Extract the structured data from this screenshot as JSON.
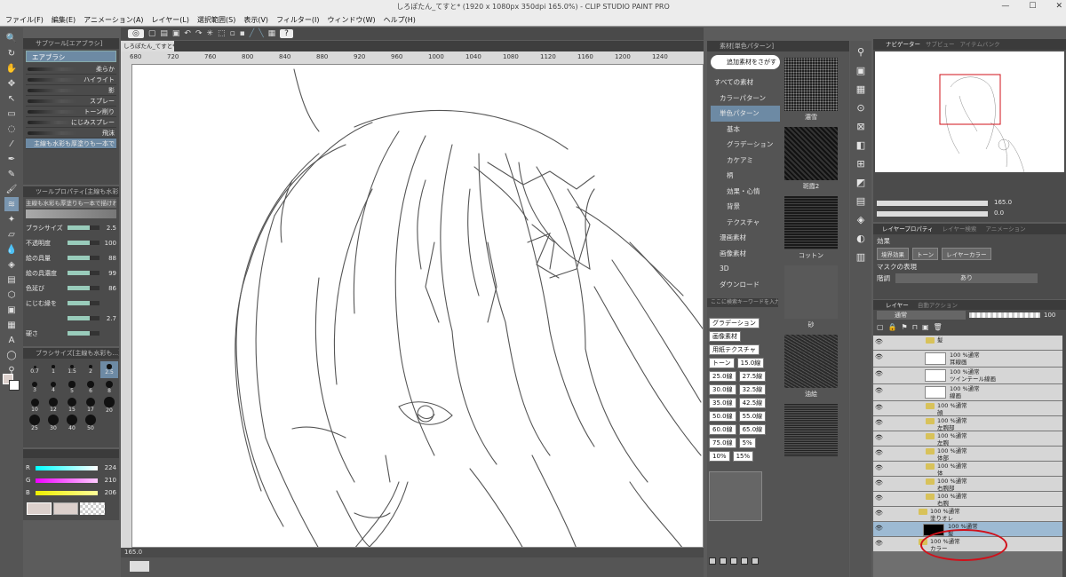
{
  "app": {
    "title": "しろぽたん_てすと* (1920 x 1080px 350dpi 165.0%) - CLIP STUDIO PAINT PRO"
  },
  "menu": [
    "ファイル(F)",
    "編集(E)",
    "アニメーション(A)",
    "レイヤー(L)",
    "選択範囲(S)",
    "表示(V)",
    "フィルター(I)",
    "ウィンドウ(W)",
    "ヘルプ(H)"
  ],
  "canvas_tab": "しろぽたん_てすと*",
  "ruler_ticks": [
    "680",
    "720",
    "760",
    "800",
    "840",
    "880",
    "920",
    "960",
    "1000",
    "1040",
    "1080",
    "1120",
    "1160",
    "1200",
    "1240"
  ],
  "status": {
    "zoom": "165.0"
  },
  "subtool": {
    "header": "サブツール[エアブラシ]",
    "group": "エアブラシ",
    "brushes": [
      "柔らか",
      "ハイライト",
      "影",
      "スプレー",
      "トーン削り",
      "にじみスプレー",
      "飛沫",
      "主線も水彩も厚塗りも一本で"
    ]
  },
  "tool_property": {
    "header": "ツールプロパティ[主線も水彩も...]",
    "name": "主線も水彩も厚塗りも一本で描ければいい",
    "props": [
      {
        "label": "ブラシサイズ",
        "value": "2.5"
      },
      {
        "label": "不透明度",
        "value": "100"
      },
      {
        "label": "絵の具量",
        "value": "88"
      },
      {
        "label": "絵の具濃度",
        "value": "99"
      },
      {
        "label": "色延び",
        "value": "86"
      },
      {
        "label": "にじむ縁を",
        "value": ""
      },
      {
        "label": "",
        "value": "2.7"
      },
      {
        "label": "硬さ",
        "value": ""
      }
    ]
  },
  "brush_size": {
    "header": "ブラシサイズ[主線も水彩も...]",
    "sizes": [
      "0.7",
      "1",
      "1.5",
      "2",
      "2.5",
      "3",
      "4",
      "5",
      "6",
      "8",
      "10",
      "12",
      "15",
      "17",
      "20",
      "25",
      "30",
      "40",
      "50"
    ]
  },
  "color_slider": {
    "rows": [
      {
        "label": "R",
        "value": "224"
      },
      {
        "label": "G",
        "value": "210"
      },
      {
        "label": "B",
        "value": "206"
      }
    ]
  },
  "material": {
    "header": "素材[単色パターン]",
    "add_button": "追加素材をさがす",
    "tree": [
      "すべての素材",
      "カラーパターン",
      "単色パターン",
      "基本",
      "グラデーション",
      "カケアミ",
      "柄",
      "効果・心情",
      "背景",
      "テクスチャ",
      "漫画素材",
      "画像素材",
      "3D",
      "ダウンロード"
    ],
    "search_placeholder": "ここに検索キーワードを入力",
    "tags": [
      "グラデーション",
      "画像素材",
      "用紙テクスチャ",
      "トーン",
      "15.0線",
      "25.0線",
      "27.5線",
      "30.0線",
      "32.5線",
      "35.0線",
      "42.5線",
      "50.0線",
      "55.0線",
      "60.0線",
      "65.0線",
      "75.0線",
      "5%",
      "10%",
      "15%"
    ],
    "thumbs": [
      "濃雪",
      "斑霞2",
      "コットン",
      "砂",
      "油絵",
      ""
    ]
  },
  "navigator": {
    "tabs": [
      "ナビゲーター",
      "サブビュー",
      "アイテムバンク"
    ],
    "zoom": "165.0",
    "rotate": "0.0"
  },
  "layer_property": {
    "tabs": [
      "レイヤープロパティ",
      "レイヤー検索",
      "アニメーション"
    ],
    "effect_label": "効果",
    "effects": [
      "境界効果",
      "トーン",
      "レイヤーカラー"
    ],
    "mask_label": "マスクの表現",
    "tone_label": "階調",
    "tone_value": "あり"
  },
  "layers": {
    "tabs": [
      "レイヤー",
      "自動アクション"
    ],
    "blend": "通常",
    "opacity": "100",
    "items": [
      {
        "pct": "",
        "name": "髪",
        "type": "folder"
      },
      {
        "pct": "100 %通常",
        "name": "耳線画",
        "type": "raster"
      },
      {
        "pct": "100 %通常",
        "name": "ツインテール線画",
        "type": "raster"
      },
      {
        "pct": "100 %通常",
        "name": "線画",
        "type": "raster"
      },
      {
        "pct": "100 %通常",
        "name": "顔",
        "type": "folder"
      },
      {
        "pct": "100 %通常",
        "name": "左腕部",
        "type": "folder"
      },
      {
        "pct": "100 %通常",
        "name": "左腕",
        "type": "folder"
      },
      {
        "pct": "100 %通常",
        "name": "体部",
        "type": "folder"
      },
      {
        "pct": "100 %通常",
        "name": "体",
        "type": "folder"
      },
      {
        "pct": "100 %通常",
        "name": "右腕部",
        "type": "folder"
      },
      {
        "pct": "100 %通常",
        "name": "右腕",
        "type": "folder"
      },
      {
        "pct": "100 %通常",
        "name": "塗りオレ",
        "type": "folder"
      },
      {
        "pct": "100 %通常",
        "name": "髪",
        "type": "selected"
      },
      {
        "pct": "100 %通常",
        "name": "カラー",
        "type": "folder"
      }
    ]
  },
  "colors": {
    "accent": "#7fb4d9",
    "selected_layer": "#9dbad3",
    "annotation": "#d0101a",
    "canvas": "#ffffff"
  }
}
